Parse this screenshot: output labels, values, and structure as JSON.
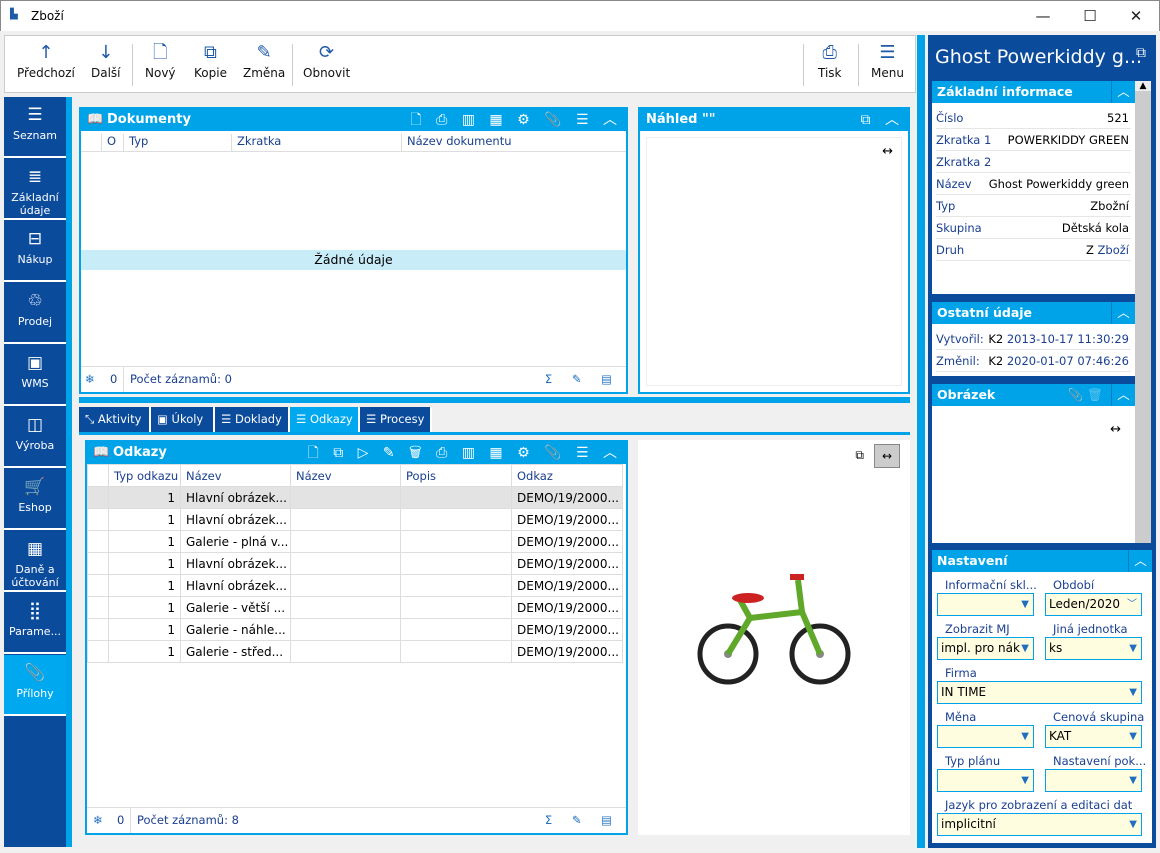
{
  "window": {
    "title": "Zboží",
    "controls": [
      "—",
      "☐",
      "✕"
    ]
  },
  "toolbar": {
    "items": [
      {
        "label": "Předchozí",
        "icon": "↑"
      },
      {
        "label": "Další",
        "icon": "↓"
      },
      {
        "label": "Nový",
        "icon": "🗋"
      },
      {
        "label": "Kopie",
        "icon": "⧉"
      },
      {
        "label": "Změna",
        "icon": "✎"
      },
      {
        "label": "Obnovit",
        "icon": "⟳"
      }
    ],
    "right": [
      {
        "label": "Tisk",
        "icon": "⎙"
      },
      {
        "label": "Menu",
        "icon": "☰"
      }
    ]
  },
  "nav": [
    {
      "label": "Seznam",
      "icon": "☰"
    },
    {
      "label": "Základní údaje",
      "icon": "≣"
    },
    {
      "label": "Nákup",
      "icon": "⊟"
    },
    {
      "label": "Prodej",
      "icon": "♲"
    },
    {
      "label": "WMS",
      "icon": "▣"
    },
    {
      "label": "Výroba",
      "icon": "◫"
    },
    {
      "label": "Eshop",
      "icon": "🛒"
    },
    {
      "label": "Daně a účtování",
      "icon": "▦"
    },
    {
      "label": "Parame...",
      "icon": "⣿"
    },
    {
      "label": "Přílohy",
      "icon": "📎"
    }
  ],
  "documents": {
    "title": "Dokumenty",
    "columns": [
      "O",
      "Typ",
      "Zkratka",
      "Název dokumentu"
    ],
    "empty": "Žádné údaje",
    "count_label": "Počet záznamů: 0",
    "selected": "0"
  },
  "preview": {
    "title": "Náhled \"\""
  },
  "tabs": [
    "Aktivity",
    "Úkoly",
    "Doklady",
    "Odkazy",
    "Procesy"
  ],
  "links": {
    "title": "Odkazy",
    "columns": [
      "Typ odkazu",
      "Název",
      "Název",
      "Popis",
      "Odkaz"
    ],
    "rows": [
      [
        "1",
        "Hlavní obrázek...",
        "",
        "",
        "DEMO/19/2000..."
      ],
      [
        "1",
        "Hlavní obrázek...",
        "",
        "",
        "DEMO/19/2000..."
      ],
      [
        "1",
        "Galerie - plná v...",
        "",
        "",
        "DEMO/19/2000..."
      ],
      [
        "1",
        "Hlavní obrázek...",
        "",
        "",
        "DEMO/19/2000..."
      ],
      [
        "1",
        "Hlavní obrázek...",
        "",
        "",
        "DEMO/19/2000..."
      ],
      [
        "1",
        "Galerie - větší ...",
        "",
        "",
        "DEMO/19/2000..."
      ],
      [
        "1",
        "Galerie - náhle...",
        "",
        "",
        "DEMO/19/2000..."
      ],
      [
        "1",
        "Galerie - střed...",
        "",
        "",
        "DEMO/19/2000..."
      ]
    ],
    "count_label": "Počet záznamů: 8",
    "selected": "0"
  },
  "right": {
    "title": "Ghost Powerkiddy g...",
    "basic": {
      "title": "Základní informace",
      "fields": [
        {
          "k": "Číslo",
          "v": "521"
        },
        {
          "k": "Zkratka 1",
          "v": "POWERKIDDY GREEN"
        },
        {
          "k": "Zkratka 2",
          "v": ""
        },
        {
          "k": "Název",
          "v": "Ghost Powerkiddy green"
        },
        {
          "k": "Typ",
          "v": "Zbožní"
        },
        {
          "k": "Skupina",
          "v": "Dětská kola"
        },
        {
          "k": "Druh",
          "v": "Z",
          "v2": "Zboží"
        }
      ]
    },
    "other": {
      "title": "Ostatní údaje",
      "fields": [
        {
          "k": "Vytvořil:",
          "u": "K2",
          "v": "2013-10-17 11:30:29"
        },
        {
          "k": "Změnil:",
          "u": "K2",
          "v": "2020-01-07 07:46:26"
        }
      ]
    },
    "image": {
      "title": "Obrázek"
    },
    "settings": {
      "title": "Nastavení",
      "fields": [
        {
          "label": "Informační skl...",
          "value": ""
        },
        {
          "label": "Období",
          "value": "Leden/2020"
        },
        {
          "label": "Zobrazit MJ",
          "value": "impl. pro nák"
        },
        {
          "label": "Jiná jednotka",
          "value": "ks"
        },
        {
          "label": "Firma",
          "value": "IN TIME"
        },
        {
          "label": "Měna",
          "value": ""
        },
        {
          "label": "Cenová skupina",
          "value": "KAT"
        },
        {
          "label": "Typ plánu",
          "value": ""
        },
        {
          "label": "Nastavení pok...",
          "value": ""
        },
        {
          "label": "Jazyk pro zobrazení a editaci dat",
          "value": "implicitní"
        }
      ]
    }
  }
}
